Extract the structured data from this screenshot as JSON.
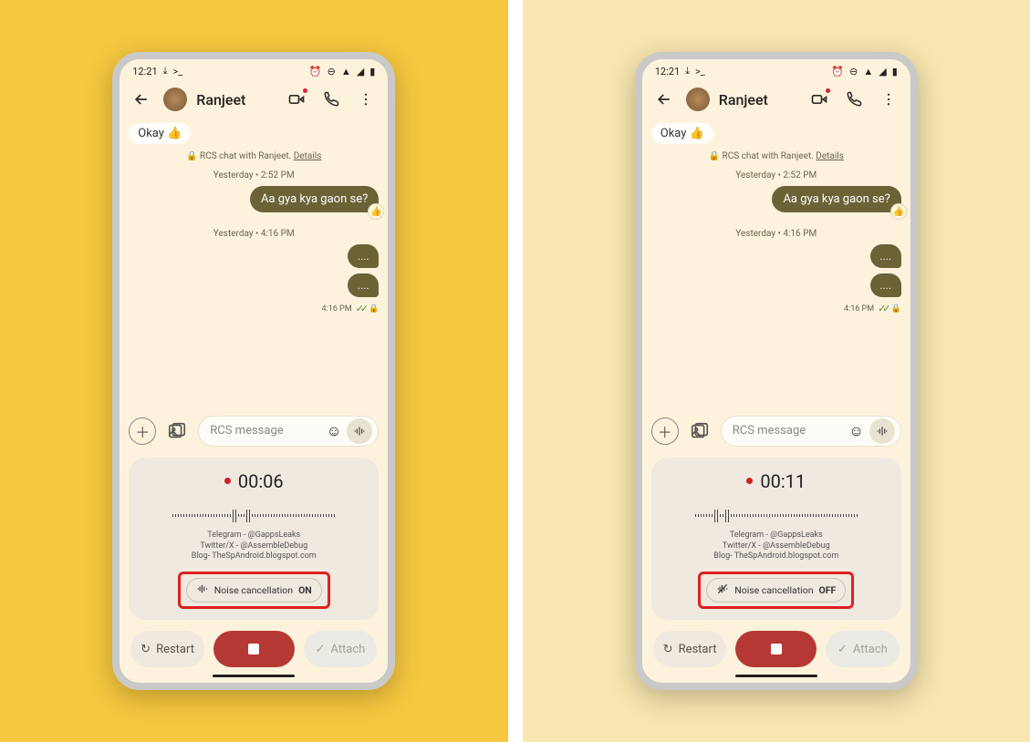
{
  "left": {
    "status": {
      "time": "12:21"
    },
    "header": {
      "contact": "Ranjeet"
    },
    "chat": {
      "okay": "Okay 👍",
      "rcs_prefix": "RCS chat with Ranjeet.",
      "rcs_details": "Details",
      "ts1": "Yesterday • 2:52 PM",
      "bubble1": "Aa gya kya gaon se?",
      "reaction": "👍",
      "ts2": "Yesterday • 4:16 PM",
      "stub": "....",
      "status_time": "4:16 PM"
    },
    "compose": {
      "placeholder": "RCS message"
    },
    "recorder": {
      "timer": "00:06",
      "credits_l1": "Telegram - @GappsLeaks",
      "credits_l2": "Twitter/X - @AssembleDebug",
      "credits_l3": "Blog- TheSpAndroid.blogspot.com",
      "nc_label": "Noise cancellation",
      "nc_state": "ON"
    },
    "actions": {
      "restart": "Restart",
      "attach": "Attach"
    }
  },
  "right": {
    "status": {
      "time": "12:21"
    },
    "header": {
      "contact": "Ranjeet"
    },
    "chat": {
      "okay": "Okay 👍",
      "rcs_prefix": "RCS chat with Ranjeet.",
      "rcs_details": "Details",
      "ts1": "Yesterday • 2:52 PM",
      "bubble1": "Aa gya kya gaon se?",
      "reaction": "👍",
      "ts2": "Yesterday • 4:16 PM",
      "stub": "....",
      "status_time": "4:16 PM"
    },
    "compose": {
      "placeholder": "RCS message"
    },
    "recorder": {
      "timer": "00:11",
      "credits_l1": "Telegram - @GappsLeaks",
      "credits_l2": "Twitter/X - @AssembleDebug",
      "credits_l3": "Blog- TheSpAndroid.blogspot.com",
      "nc_label": "Noise cancellation",
      "nc_state": "OFF"
    },
    "actions": {
      "restart": "Restart",
      "attach": "Attach"
    }
  }
}
